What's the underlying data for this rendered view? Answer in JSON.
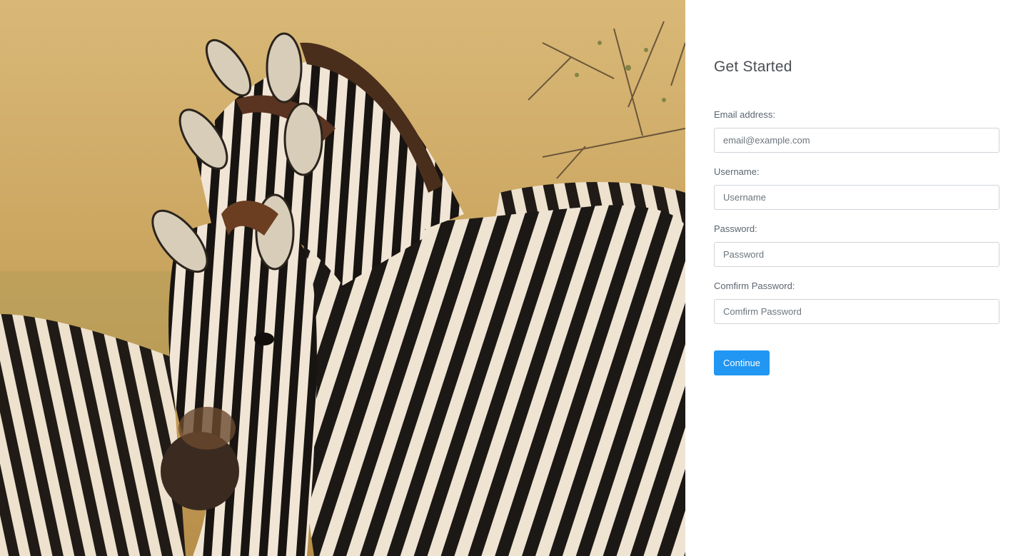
{
  "hero": {
    "image": "zebras-photo"
  },
  "form": {
    "title": "Get Started",
    "fields": [
      {
        "label": "Email address:",
        "placeholder": "email@example.com",
        "value": ""
      },
      {
        "label": "Username:",
        "placeholder": "Username",
        "value": ""
      },
      {
        "label": "Password:",
        "placeholder": "Password",
        "value": ""
      },
      {
        "label": "Comfirm Password:",
        "placeholder": "Comfirm Password",
        "value": ""
      }
    ],
    "submit_label": "Continue"
  },
  "colors": {
    "accent": "#2196f3",
    "title": "#4a4f55",
    "label": "#5c6670",
    "input_border": "#ced4da"
  }
}
